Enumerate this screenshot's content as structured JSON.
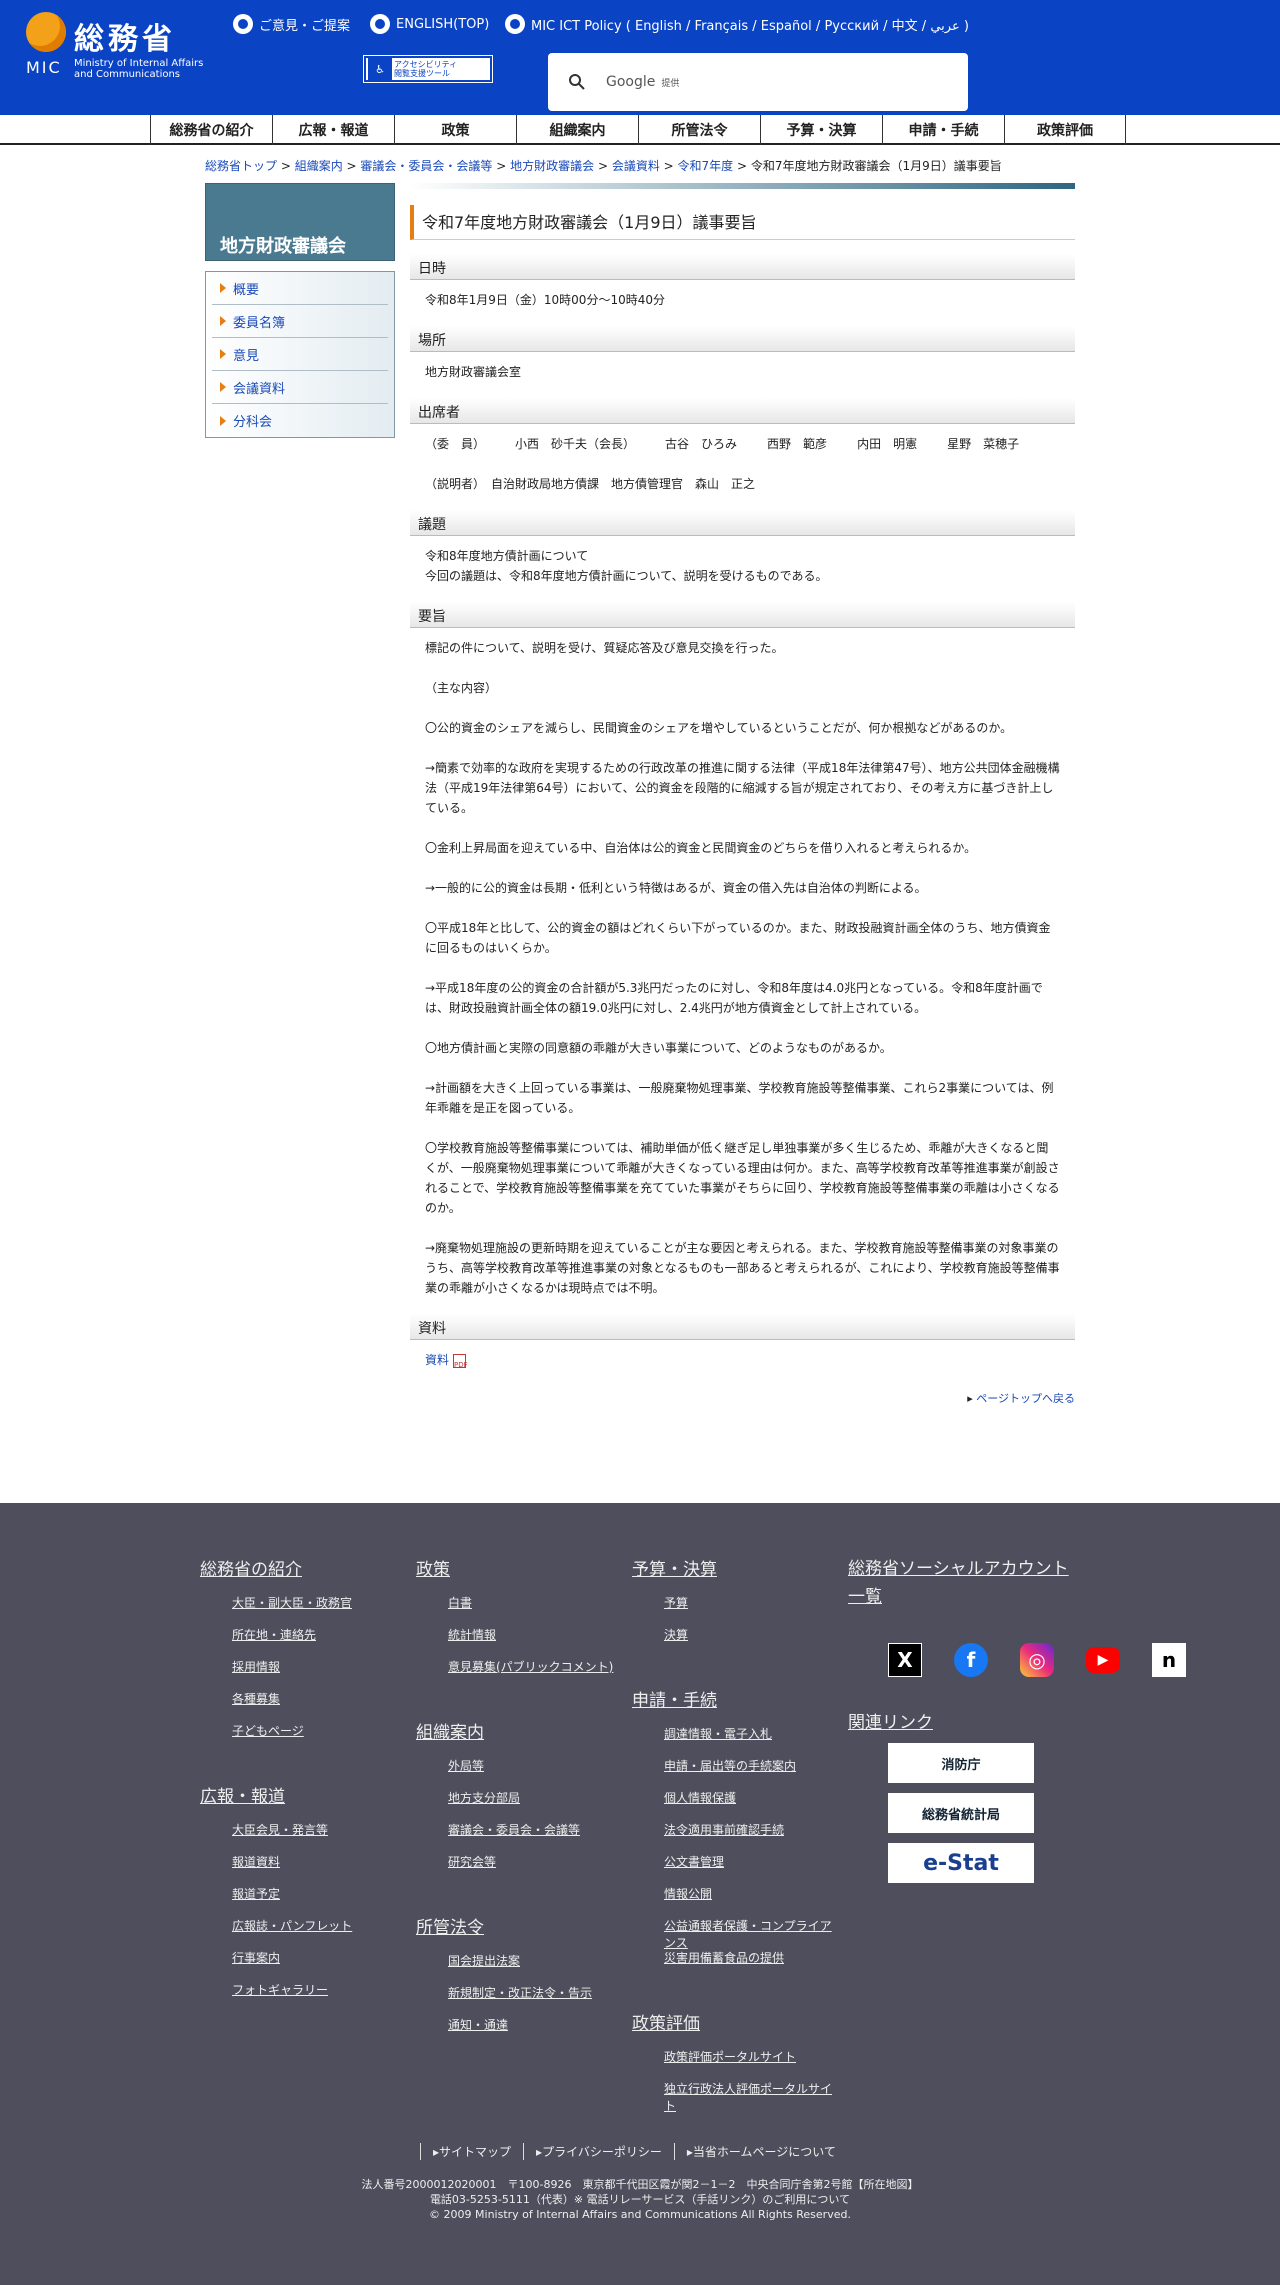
{
  "header": {
    "logo_jp": "総務省",
    "logo_mic": "MIC",
    "logo_en_1": "Ministry of Internal Affairs",
    "logo_en_2": "and Communications",
    "links": [
      "ご意見・ご提案",
      "ENGLISH(TOP)",
      "MIC ICT Policy ( English / Français / Español / Русский / 中文 / عربي )"
    ],
    "access_1": "アクセシビリティ",
    "access_2": "閲覧支援ツール",
    "search_brand": "Google",
    "search_provided": "提供"
  },
  "gnav": [
    "総務省の紹介",
    "広報・報道",
    "政策",
    "組織案内",
    "所管法令",
    "予算・決算",
    "申請・手続",
    "政策評価"
  ],
  "breadcrumb": {
    "items": [
      "総務省トップ",
      "組織案内",
      "審議会・委員会・会議等",
      "地方財政審議会",
      "会議資料",
      "令和7年度"
    ],
    "sep": " > ",
    "current": "令和7年度地方財政審議会（1月9日）議事要旨"
  },
  "sidebar": {
    "title": "地方財政審議会",
    "items": [
      "概要",
      "委員名簿",
      "意見",
      "会議資料",
      "分科会"
    ]
  },
  "main": {
    "title": "令和7年度地方財政審議会（1月9日）議事要旨",
    "s1": "日時",
    "datetime": "令和8年1月9日（金）10時00分～10時40分",
    "s2": "場所",
    "place": "地方財政審議会室",
    "s3": "出席者",
    "att_role": "（委　員）",
    "attendees": [
      "小西　砂千夫（会長）",
      "古谷　ひろみ",
      "西野　範彦",
      "内田　明憲",
      "星野　菜穂子"
    ],
    "explainer": "（説明者）　自治財政局地方債課　地方債管理官　森山　正之",
    "s4": "議題",
    "agenda_1": "令和8年度地方債計画について",
    "agenda_2": "今回の議題は、令和8年度地方債計画について、説明を受けるものである。",
    "s5": "要旨",
    "summary": [
      "標記の件について、説明を受け、質疑応答及び意見交換を行った。",
      "（主な内容）",
      "〇公的資金のシェアを減らし、民間資金のシェアを増やしているということだが、何か根拠などがあるのか。",
      "→簡素で効率的な政府を実現するための行政改革の推進に関する法律（平成18年法律第47号）、地方公共団体金融機構法（平成19年法律第64号）において、公的資金を段階的に縮減する旨が規定されており、その考え方に基づき計上している。",
      "〇金利上昇局面を迎えている中、自治体は公的資金と民間資金のどちらを借り入れると考えられるか。",
      "→一般的に公的資金は長期・低利という特徴はあるが、資金の借入先は自治体の判断による。",
      "〇平成18年と比して、公的資金の額はどれくらい下がっているのか。また、財政投融資計画全体のうち、地方債資金に回るものはいくらか。",
      "→平成18年度の公的資金の合計額が5.3兆円だったのに対し、令和8年度は4.0兆円となっている。令和8年度計画では、財政投融資計画全体の額19.0兆円に対し、2.4兆円が地方債資金として計上されている。",
      "〇地方債計画と実際の同意額の乖離が大きい事業について、どのようなものがあるか。",
      "→計画額を大きく上回っている事業は、一般廃棄物処理事業、学校教育施設等整備事業、これら2事業については、例年乖離を是正を図っている。",
      "〇学校教育施設等整備事業については、補助単価が低く継ぎ足し単独事業が多く生じるため、乖離が大きくなると聞くが、一般廃棄物処理事業について乖離が大きくなっている理由は何か。また、高等学校教育改革等推進事業が創設されることで、学校教育施設等整備事業を充てていた事業がそちらに回り、学校教育施設等整備事業の乖離は小さくなるのか。",
      "→廃棄物処理施設の更新時期を迎えていることが主な要因と考えられる。また、学校教育施設等整備事業の対象事業のうち、高等学校教育改革等推進事業の対象となるものも一部あると考えられるが、これにより、学校教育施設等整備事業の乖離が小さくなるかは現時点では不明。"
    ],
    "s6": "資料",
    "material": "資料",
    "pdf_icon": "pdf-icon",
    "pagetop": "ページトップへ戻る"
  },
  "footer": {
    "intro": {
      "title": "総務省の紹介",
      "items": [
        "大臣・副大臣・政務官",
        "所在地・連絡先",
        "採用情報",
        "各種募集",
        "子どもページ"
      ]
    },
    "press": {
      "title": "広報・報道",
      "items": [
        "大臣会見・発言等",
        "報道資料",
        "報道予定",
        "広報誌・パンフレット",
        "行事案内",
        "フォトギャラリー"
      ]
    },
    "policy": {
      "title": "政策",
      "items": [
        "白書",
        "統計情報",
        "意見募集(パブリックコメント)"
      ]
    },
    "org": {
      "title": "組織案内",
      "items": [
        "外局等",
        "地方支分部局",
        "審議会・委員会・会議等",
        "研究会等"
      ]
    },
    "law": {
      "title": "所管法令",
      "items": [
        "国会提出法案",
        "新規制定・改正法令・告示",
        "通知・通達"
      ]
    },
    "budget": {
      "title": "予算・決算",
      "items": [
        "予算",
        "決算"
      ]
    },
    "apply": {
      "title": "申請・手続",
      "items": [
        "調達情報・電子入札",
        "申請・届出等の手続案内",
        "個人情報保護",
        "法令適用事前確認手続",
        "公文書管理",
        "情報公開",
        "公益通報者保護・コンプライアンス",
        "災害用備蓄食品の提供"
      ]
    },
    "eval": {
      "title": "政策評価",
      "items": [
        "政策評価ポータルサイト",
        "独立行政法人評価ポータルサイト"
      ]
    },
    "social_title": "総務省ソーシャルアカウント一覧",
    "social": [
      "x-icon",
      "facebook-icon",
      "instagram-icon",
      "youtube-icon",
      "note-icon"
    ],
    "related_title": "関連リンク",
    "related": [
      "消防庁",
      "総務省統計局",
      "e-Stat"
    ],
    "nav": [
      "サイトマップ",
      "プライバシーポリシー",
      "当省ホームページについて"
    ],
    "corp": "法人番号2000012020001　〒100-8926　東京都千代田区霞が関2－1－2　中央合同庁舎第2号館【",
    "map": "所在地図",
    "corp_end": "】",
    "tel": "電話03-5253-5111（代表）",
    "tel_link": "※ 電話リレーサービス（手話リンク）のご利用について",
    "copy": "© 2009 Ministry of Internal Affairs and Communications All Rights Reserved."
  }
}
